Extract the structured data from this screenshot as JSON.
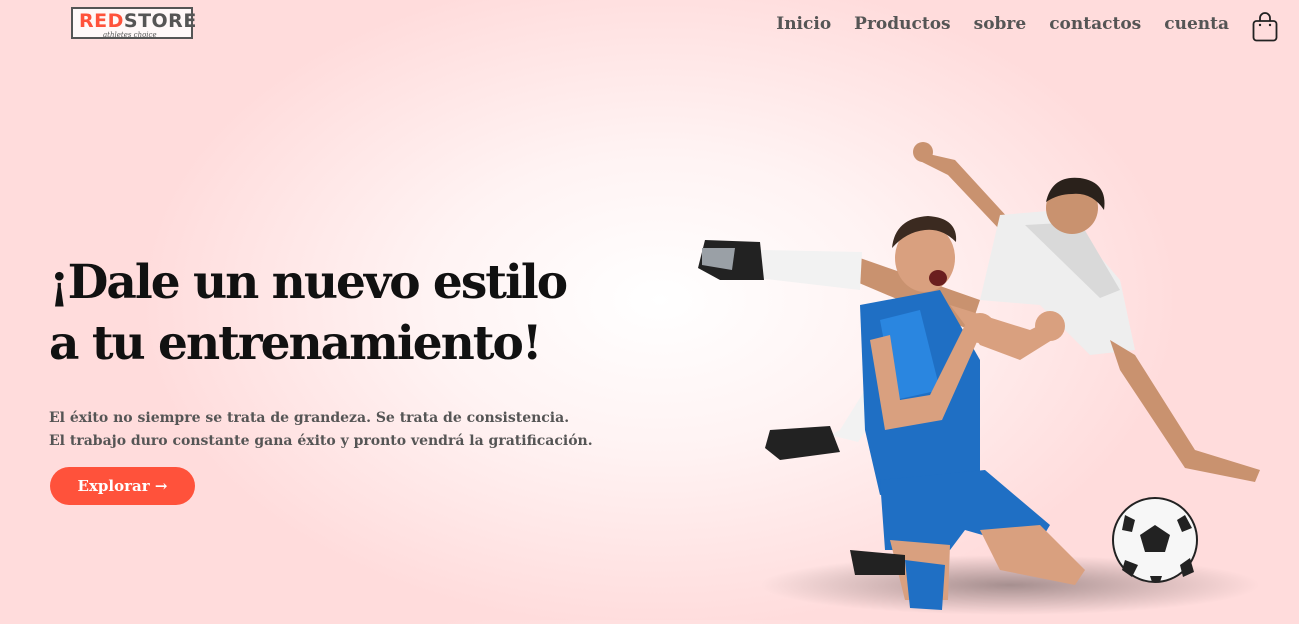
{
  "logo": {
    "brand_red": "RED",
    "brand_dark": "STORE",
    "tagline": "athletes choice"
  },
  "nav": {
    "items": [
      {
        "label": "Inicio"
      },
      {
        "label": "Productos"
      },
      {
        "label": "sobre"
      },
      {
        "label": "contactos"
      },
      {
        "label": "cuenta"
      }
    ],
    "cart_icon": "shopping-bag-icon"
  },
  "hero": {
    "title_line1": "¡Dale un nuevo estilo",
    "title_line2": "a tu entrenamiento!",
    "desc_line1": "El éxito no siempre se trata de grandeza. Se trata de consistencia.",
    "desc_line2": "El trabajo duro constante gana éxito y pronto vendrá la gratificación.",
    "cta_label": "Explorar →"
  },
  "colors": {
    "accent": "#ff523b",
    "text_dark": "#111111",
    "text_muted": "#555555",
    "bg_pink": "#ffdcdc"
  }
}
